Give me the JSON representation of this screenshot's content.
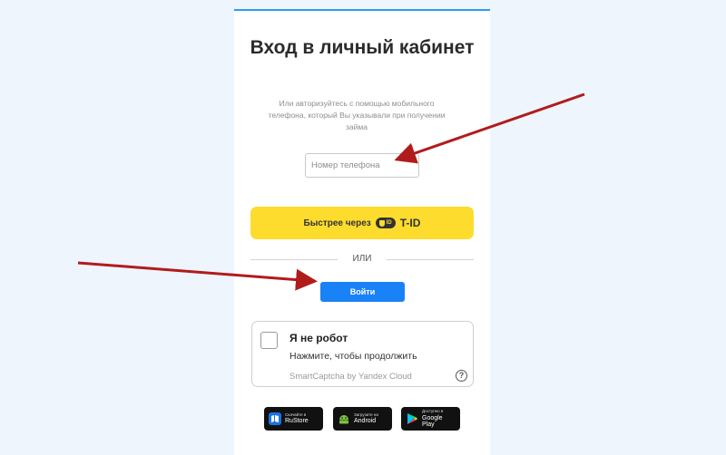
{
  "colors": {
    "page_bg": "#eef5fc",
    "accent_top": "#2a9bf0",
    "tid_yellow": "#fddc2d",
    "primary_button": "#1a82f7",
    "annotation_arrow": "#b01c1c"
  },
  "page": {
    "title": "Вход в личный кабинет",
    "subtitle": "Или авторизуйтесь с помощью мобильного телефона, который Вы указывали при получении займа"
  },
  "phone": {
    "placeholder": "Номер телефона",
    "value": ""
  },
  "tid": {
    "label": "Быстрее через",
    "badge": "ID",
    "brand": "T-ID"
  },
  "divider": {
    "label": "ИЛИ"
  },
  "login": {
    "label": "Войти"
  },
  "captcha": {
    "title": "Я не робот",
    "subtitle": "Нажмите, чтобы продолжить",
    "brand": "SmartCaptcha by Yandex Cloud",
    "help": "?",
    "checked": false
  },
  "stores": [
    {
      "small": "Скачайте в",
      "name": "RuStore",
      "icon": "rustore-icon"
    },
    {
      "small": "Загрузите на",
      "name": "Android",
      "icon": "android-icon"
    },
    {
      "small": "Доступно в",
      "name": "Google Play",
      "icon": "google-play-icon"
    }
  ]
}
